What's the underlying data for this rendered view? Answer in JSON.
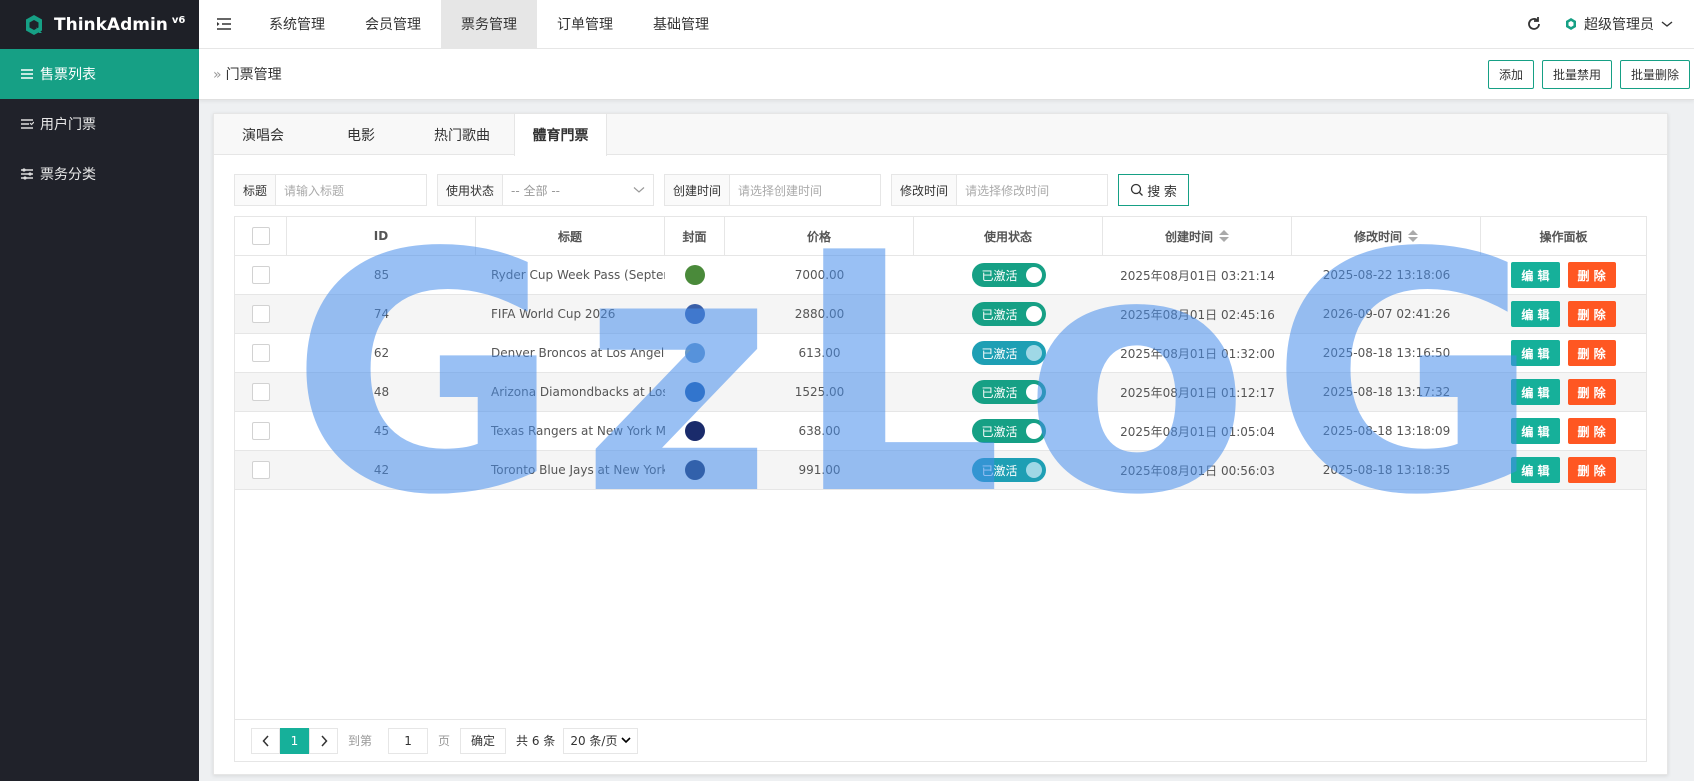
{
  "app": {
    "name": "ThinkAdmin",
    "version": "v6"
  },
  "sidebar": {
    "items": [
      {
        "label": "售票列表",
        "active": true
      },
      {
        "label": "用户门票",
        "active": false
      },
      {
        "label": "票务分类",
        "active": false
      }
    ]
  },
  "topnav": {
    "items": [
      "系统管理",
      "会员管理",
      "票务管理",
      "订单管理",
      "基础管理"
    ],
    "active_index": 2
  },
  "user": {
    "name": "超级管理员"
  },
  "breadcrumb": {
    "title": "门票管理"
  },
  "actions": {
    "add": "添加",
    "batch_disable": "批量禁用",
    "batch_delete": "批量删除"
  },
  "tabs": [
    "演唱会",
    "电影",
    "热门歌曲",
    "體育門票"
  ],
  "active_tab": 3,
  "filters": {
    "title_label": "标题",
    "title_placeholder": "请输入标题",
    "status_label": "使用状态",
    "status_value": "-- 全部 --",
    "created_label": "创建时间",
    "created_placeholder": "请选择创建时间",
    "modified_label": "修改时间",
    "modified_placeholder": "请选择修改时间",
    "search_label": "搜 索"
  },
  "table": {
    "headers": {
      "id": "ID",
      "title": "标题",
      "cover": "封面",
      "price": "价格",
      "status": "使用状态",
      "created": "创建时间",
      "modified": "修改时间",
      "ops": "操作面板"
    },
    "rows": [
      {
        "id": "85",
        "title": "Ryder Cup Week Pass (September",
        "cover": "golf",
        "cover_color": "#4a8a3a",
        "price": "7000.00",
        "status": "已激活",
        "status_on": true,
        "created": "2025年08月01日 03:21:14",
        "modified": "2025-08-22 13:18:06"
      },
      {
        "id": "74",
        "title": "FIFA World Cup 2026",
        "cover": "fifa",
        "cover_color": "#3a5fa8",
        "price": "2880.00",
        "status": "已激活",
        "status_on": true,
        "created": "2025年08月01日 02:45:16",
        "modified": "2026-09-07 02:41:26"
      },
      {
        "id": "62",
        "title": "Denver Broncos at Los Angeles C",
        "cover": "chargers",
        "cover_color": "#6a9ac8",
        "price": "613.00",
        "status": "已激活",
        "status_on": false,
        "created": "2025年08月01日 01:32:00",
        "modified": "2025-08-18 13:16:50"
      },
      {
        "id": "48",
        "title": "Arizona Diamondbacks at Los An",
        "cover": "LA",
        "cover_color": "#1c5aa8",
        "price": "1525.00",
        "status": "已激活",
        "status_on": true,
        "created": "2025年08月01日 01:12:17",
        "modified": "2025-08-18 13:17:32"
      },
      {
        "id": "45",
        "title": "Texas Rangers at New York Mets",
        "cover": "NY",
        "cover_color": "#1a2b6b",
        "price": "638.00",
        "status": "已激活",
        "status_on": true,
        "created": "2025年08月01日 01:05:04",
        "modified": "2025-08-18 13:18:09"
      },
      {
        "id": "42",
        "title": "Toronto Blue Jays at New York Y",
        "cover": "NY",
        "cover_color": "#1c2d5e",
        "price": "991.00",
        "status": "已激活",
        "status_on": false,
        "created": "2025年08月01日 00:56:03",
        "modified": "2025-08-18 13:18:35"
      }
    ],
    "edit_label": "编 辑",
    "delete_label": "删 除"
  },
  "pager": {
    "current": "1",
    "goto_label": "到第",
    "page_input": "1",
    "page_label": "页",
    "confirm": "确定",
    "total": "共 6 条",
    "per_page": "20 条/页"
  },
  "watermark": "GzLoG"
}
